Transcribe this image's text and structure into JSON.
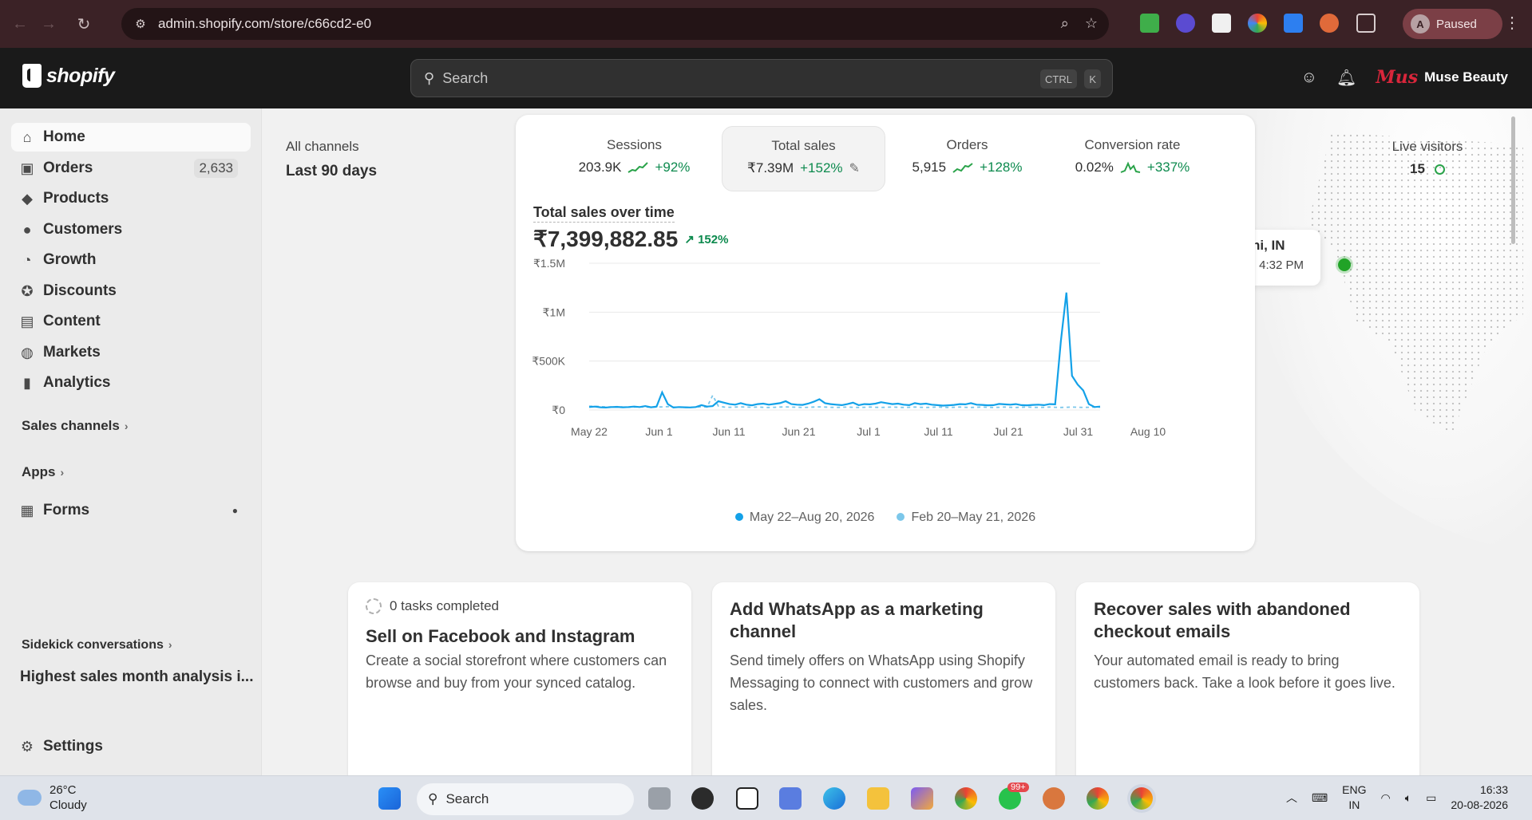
{
  "browser": {
    "url": "admin.shopify.com/store/c66cd2-e0",
    "profile_initial": "A",
    "profile_status": "Paused"
  },
  "topbar": {
    "logo_text": "shopify",
    "search_placeholder": "Search",
    "shortcut_1": "CTRL",
    "shortcut_2": "K",
    "store_logo_text": "Mus",
    "store_name": "Muse Beauty"
  },
  "sidebar": {
    "items": [
      {
        "label": "Home",
        "icon": "home-icon"
      },
      {
        "label": "Orders",
        "icon": "inbox-icon",
        "count": "2,633"
      },
      {
        "label": "Products",
        "icon": "tag-icon"
      },
      {
        "label": "Customers",
        "icon": "person-icon"
      },
      {
        "label": "Growth",
        "icon": "gauge-icon"
      },
      {
        "label": "Discounts",
        "icon": "discount-icon"
      },
      {
        "label": "Content",
        "icon": "image-icon"
      },
      {
        "label": "Markets",
        "icon": "globe-icon"
      },
      {
        "label": "Analytics",
        "icon": "bar-chart-icon"
      }
    ],
    "sales_channels": "Sales channels",
    "apps": "Apps",
    "forms": "Forms",
    "sidekick": "Sidekick conversations",
    "sidekick_item": "Highest sales month analysis i...",
    "settings": "Settings"
  },
  "filters": {
    "channel": "All channels",
    "period": "Last 90 days"
  },
  "metrics": [
    {
      "title": "Sessions",
      "value": "203.9K",
      "change": "+92%"
    },
    {
      "title": "Total sales",
      "value": "₹7.39M",
      "change": "+152%"
    },
    {
      "title": "Orders",
      "value": "5,915",
      "change": "+128%"
    },
    {
      "title": "Conversion rate",
      "value": "0.02%",
      "change": "+337%"
    }
  ],
  "chart_title": "Total sales over time",
  "chart_total": "₹7,399,882.85",
  "chart_change": "152%",
  "chart_data": {
    "type": "line",
    "x_ticks": [
      "May 22",
      "Jun 1",
      "Jun 11",
      "Jun 21",
      "Jul 1",
      "Jul 11",
      "Jul 21",
      "Jul 31",
      "Aug 10"
    ],
    "y_ticks": [
      "₹1.5M",
      "₹1M",
      "₹500K",
      "₹0"
    ],
    "ylim": [
      0,
      1500000
    ],
    "series": [
      {
        "name": "May 22–Aug 20, 2026",
        "color": "#13a1e8",
        "values": [
          30000,
          35000,
          28000,
          25000,
          30000,
          32000,
          28000,
          30000,
          35000,
          30000,
          40000,
          28000,
          35000,
          180000,
          60000,
          25000,
          30000,
          28000,
          26000,
          30000,
          50000,
          35000,
          40000,
          90000,
          75000,
          60000,
          55000,
          70000,
          55000,
          48000,
          60000,
          65000,
          55000,
          62000,
          70000,
          90000,
          60000,
          55000,
          52000,
          65000,
          85000,
          110000,
          70000,
          60000,
          55000,
          50000,
          60000,
          75000,
          50000,
          60000,
          58000,
          65000,
          80000,
          70000,
          60000,
          65000,
          55000,
          50000,
          70000,
          60000,
          65000,
          55000,
          50000,
          45000,
          48000,
          52000,
          60000,
          58000,
          70000,
          55000,
          52000,
          48000,
          50000,
          62000,
          58000,
          55000,
          60000,
          50000,
          48000,
          52000,
          55000,
          50000,
          60000,
          58000,
          700000,
          1200000,
          350000,
          260000,
          200000,
          60000,
          30000,
          35000
        ]
      },
      {
        "name": "Feb 20–May 21, 2026",
        "color": "#7cc7ea",
        "values": [
          40000,
          38000,
          35000,
          30000,
          32000,
          34000,
          30000,
          28000,
          30000,
          32000,
          30000,
          28000,
          30000,
          32000,
          34000,
          30000,
          28000,
          26000,
          28000,
          30000,
          32000,
          30000,
          150000,
          40000,
          30000,
          28000,
          30000,
          32000,
          30000,
          28000,
          30000,
          28000,
          26000,
          28000,
          30000,
          32000,
          30000,
          28000,
          26000,
          28000,
          30000,
          32000,
          30000,
          28000,
          26000,
          28000,
          30000,
          28000,
          26000,
          28000,
          30000,
          28000,
          26000,
          28000,
          30000,
          28000,
          26000,
          28000,
          30000,
          28000,
          26000,
          28000,
          30000,
          28000,
          26000,
          28000,
          30000,
          28000,
          26000,
          28000,
          30000,
          28000,
          26000,
          28000,
          30000,
          28000,
          26000,
          28000,
          30000,
          28000,
          26000,
          28000,
          30000,
          28000,
          26000,
          28000,
          30000,
          28000,
          26000,
          28000,
          30000,
          28000
        ]
      }
    ]
  },
  "live": {
    "title": "Live visitors",
    "count": "15"
  },
  "map_pin": {
    "place": "ni, IN",
    "time": "· 4:32 PM"
  },
  "task_cards": [
    {
      "count": "0 tasks completed",
      "title": "Sell on Facebook and Instagram",
      "desc": "Create a social storefront where customers can browse and buy from your synced catalog."
    },
    {
      "title": "Add WhatsApp as a marketing channel",
      "desc": "Send timely offers on WhatsApp using Shopify Messaging to connect with customers and grow sales."
    },
    {
      "title": "Recover sales with abandoned checkout emails",
      "desc": "Your automated email is ready to bring customers back. Take a look before it goes live."
    }
  ],
  "taskbar": {
    "temp": "26°C",
    "weather": "Cloudy",
    "search": "Search",
    "badge_whatsapp": "99+",
    "lang1": "ENG",
    "lang2": "IN",
    "time": "16:33",
    "date": "20-08-2026"
  }
}
